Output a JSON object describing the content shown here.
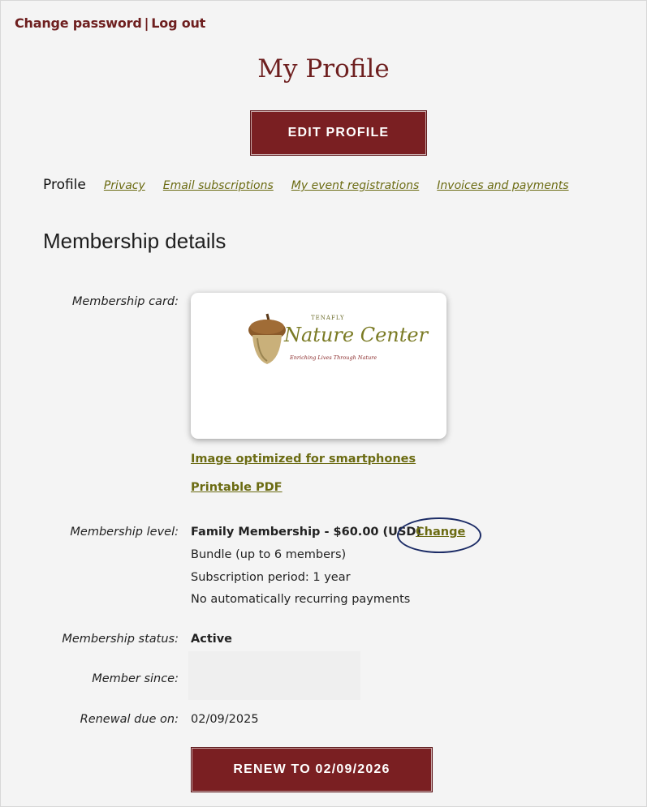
{
  "top_links": {
    "change_password": "Change password",
    "separator": "|",
    "log_out": "Log out"
  },
  "page_title": "My Profile",
  "edit_button": "EDIT PROFILE",
  "tabs": {
    "current": "Profile",
    "links": [
      "Privacy",
      "Email subscriptions",
      "My event registrations",
      "Invoices and payments"
    ]
  },
  "section_title": "Membership details",
  "membership_card": {
    "label": "Membership card:",
    "logo_small": "TENAFLY",
    "logo_big": "Nature Center",
    "logo_tag": "Enriching Lives Through Nature",
    "link_smartphone": "Image optimized for smartphones",
    "link_pdf": "Printable PDF"
  },
  "membership_level": {
    "label": "Membership level:",
    "value": "Family Membership - $60.00 (USD)",
    "change_link": "Change",
    "bundle": "Bundle (up to 6 members)",
    "period": "Subscription period: 1 year",
    "recurring": "No automatically recurring payments"
  },
  "membership_status": {
    "label": "Membership status:",
    "value": "Active"
  },
  "member_since": {
    "label": "Member since:",
    "value": ""
  },
  "renewal": {
    "label": "Renewal due on:",
    "value": "02/09/2025",
    "button": "RENEW TO 02/09/2026"
  },
  "colors": {
    "brand": "#7a1f22",
    "link": "#6b6b12",
    "highlight_ellipse": "#1c2c66"
  }
}
